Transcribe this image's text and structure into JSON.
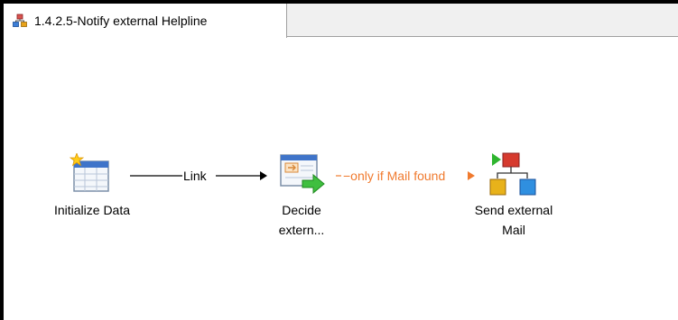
{
  "tab": {
    "title": "1.4.2.5-Notify external Helpline",
    "icon": "workflow-icon"
  },
  "nodes": {
    "initialize": {
      "label": "Initialize Data",
      "icon": "table-new-icon"
    },
    "decide": {
      "label_line1": "Decide",
      "label_line2": "extern...",
      "icon": "decision-icon"
    },
    "send": {
      "label_line1": "Send external",
      "label_line2": "Mail",
      "icon": "process-blocks-icon"
    }
  },
  "connectors": {
    "link": {
      "label": "Link",
      "color": "#000000"
    },
    "conditional": {
      "label": "only if Mail found",
      "color": "#f07a2e"
    }
  }
}
